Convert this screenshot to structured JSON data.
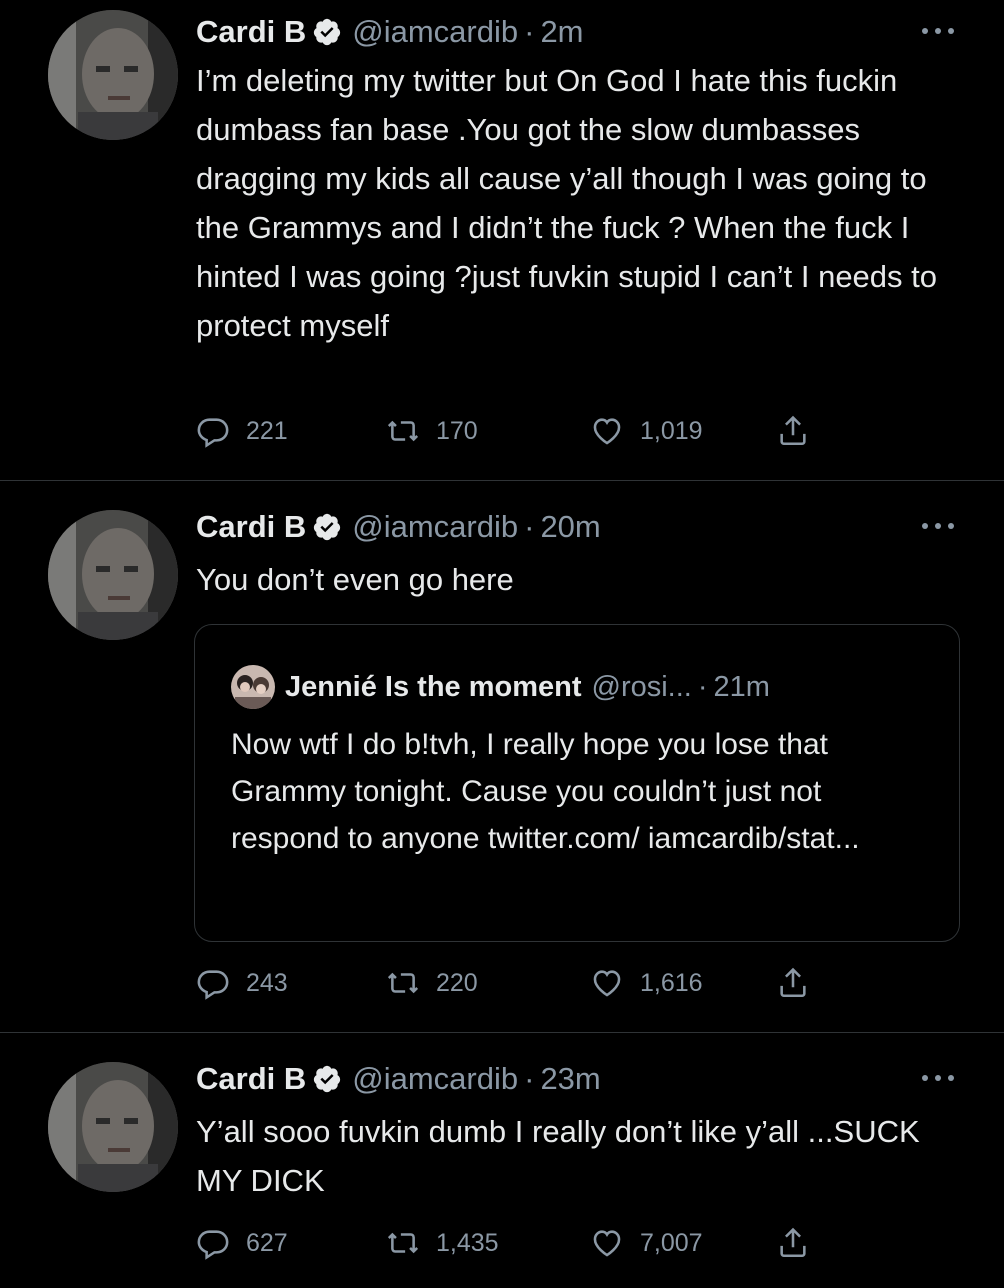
{
  "tweets": [
    {
      "name": "Cardi B",
      "handle": "@iamcardib",
      "dot": "·",
      "time": "2m",
      "text": "I’m deleting my twitter but On God I hate this fuckin dumbass fan base .You got the slow dumbasses dragging my kids all cause y’all though I was going to the Grammys and I didn’t the fuck ? When the fuck I hinted I was going ?just fuvkin stupid I can’t I needs to protect myself",
      "replies": "221",
      "retweets": "170",
      "likes": "1,019"
    },
    {
      "name": "Cardi B",
      "handle": "@iamcardib",
      "dot": "·",
      "time": "20m",
      "text": "You don’t even go here",
      "quote": {
        "name": "Jennié Is the moment",
        "handle": "@rosi...",
        "dot": "·",
        "time": "21m",
        "text": "Now wtf I do b!tvh, I really hope you lose that Grammy tonight. Cause you couldn’t just not respond to anyone twitter.com/ iamcardib/stat..."
      },
      "replies": "243",
      "retweets": "220",
      "likes": "1,616"
    },
    {
      "name": "Cardi B",
      "handle": "@iamcardib",
      "dot": "·",
      "time": "23m",
      "text": "Y’all sooo fuvkin dumb I really don’t like y’all ...SUCK MY DICK",
      "replies": "627",
      "retweets": "1,435",
      "likes": "7,007"
    }
  ],
  "colors": {
    "background": "#000000",
    "text": "#e7e9ea",
    "muted": "#8b98a5",
    "divider": "#2f3336"
  },
  "icons": [
    "verified-badge-icon",
    "more-icon",
    "reply-icon",
    "retweet-icon",
    "like-icon",
    "share-icon"
  ]
}
